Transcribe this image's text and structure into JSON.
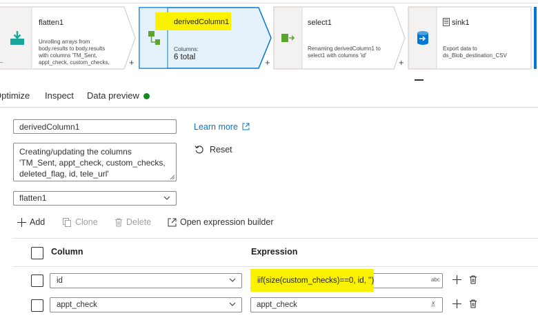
{
  "pipeline": {
    "nodes": [
      {
        "title": "flatten1",
        "description": [
          "Unrolling arrays from",
          "body.results to body.results",
          "with columns 'TM_Sent,",
          "appt_check, custom_checks,"
        ]
      },
      {
        "title": "derivedColumn1",
        "columns_label": "Columns:",
        "columns_count": "6 total"
      },
      {
        "title": "select1",
        "description": [
          "Renaming derivedColumn1 to",
          "select1 with columns 'id'"
        ]
      },
      {
        "title": "sink1",
        "description": [
          "Export data to",
          "ds_Blob_destination_CSV"
        ]
      }
    ],
    "add_label": "+"
  },
  "tabs": [
    {
      "label": "Optimize"
    },
    {
      "label": "Inspect"
    },
    {
      "label": "Data preview"
    }
  ],
  "form": {
    "output_stream_name": "derivedColumn1",
    "description": "Creating/updating the columns 'TM_Sent, appt_check, custom_checks, deleted_flag, id, tele_url'",
    "incoming_stream": "flatten1",
    "learn_more": "Learn more",
    "reset": "Reset"
  },
  "toolbar": {
    "add": "Add",
    "clone": "Clone",
    "delete": "Delete",
    "open_builder": "Open expression builder"
  },
  "grid": {
    "column_header": "Column",
    "expression_header": "Expression",
    "rows": [
      {
        "column": "id",
        "expression": "iif(size(custom_checks)==0, id, '')",
        "type_badge": "abc"
      },
      {
        "column": "appt_check",
        "expression": "appt_check",
        "type_badge": "x̲"
      }
    ]
  },
  "colors": {
    "accent": "#0078d4",
    "highlight": "#faf200",
    "status_green": "#12891a",
    "selected_node_fill": "#e5f1fb"
  }
}
